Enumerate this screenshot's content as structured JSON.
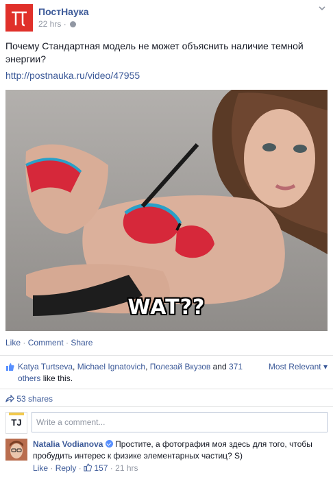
{
  "post": {
    "page_name": "ПостНаука",
    "logo_glyph": "π",
    "time": "22 hrs",
    "separator": "·",
    "text": "Почему Стандартная модель не может объяснить наличие темной энергии?",
    "link": "http://postnauka.ru/video/47955",
    "image_caption": "WAT??",
    "brand_color": "#e0302a",
    "link_color": "#3b5998"
  },
  "actions": {
    "like": "Like",
    "comment": "Comment",
    "share": "Share",
    "sep": " · "
  },
  "likes": {
    "user1": "Katya Turtseva",
    "user2": "Michael Ignatovich",
    "user3": "Полезай Вкузов",
    "and": "and",
    "others": "371 others",
    "suffix": "like this.",
    "sort_label": "Most Relevant"
  },
  "shares": {
    "label": "53 shares"
  },
  "comment_box": {
    "avatar_text": "TJ",
    "placeholder": "Write a comment..."
  },
  "comment": {
    "author": "Natalia Vodianova",
    "text": "Простите, а фотография моя здесь для того, чтобы пробудить интерес к физике элементарных частиц? S)",
    "like": "Like",
    "reply": "Reply",
    "like_count": "157",
    "time": "21 hrs"
  }
}
